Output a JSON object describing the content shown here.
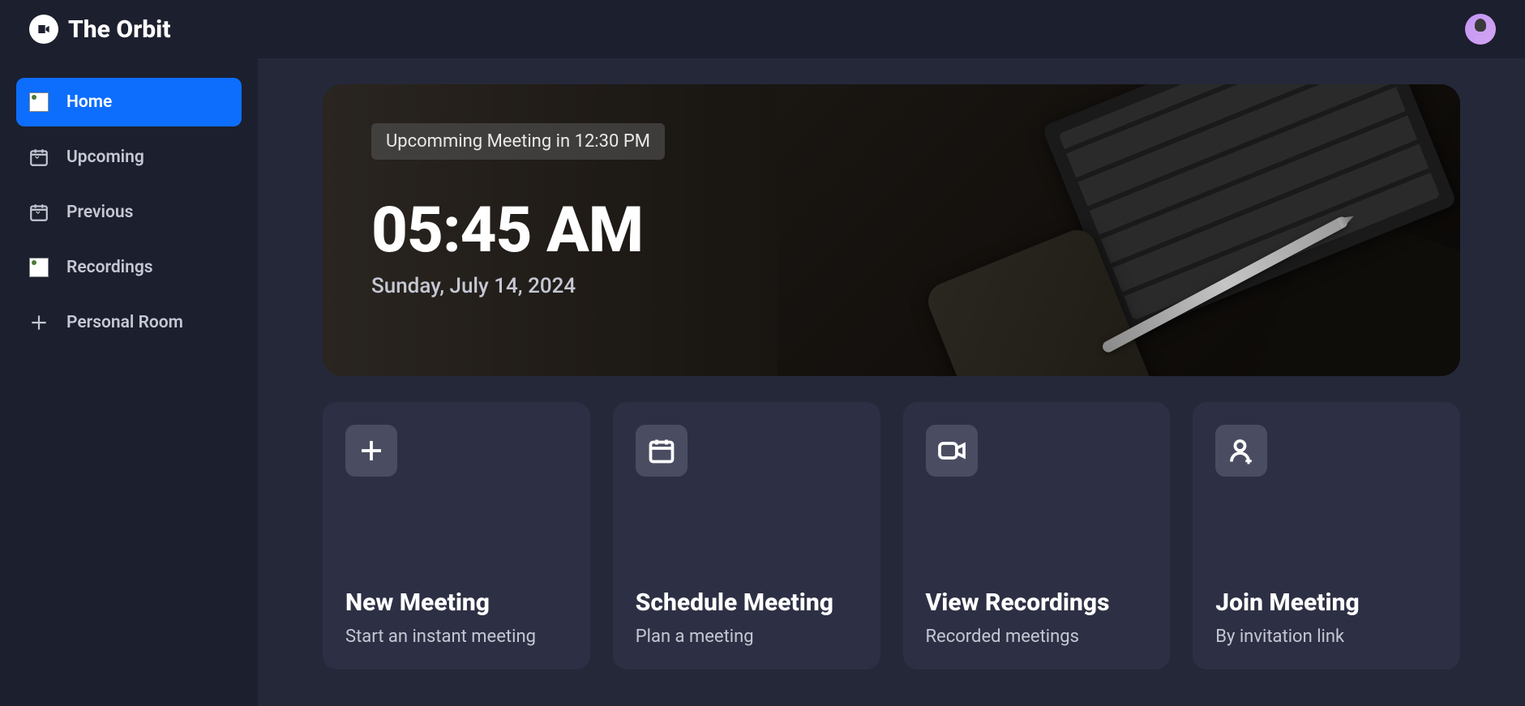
{
  "brand": {
    "name": "The Orbit"
  },
  "sidebar": {
    "items": [
      {
        "label": "Home",
        "icon": "home-icon",
        "active": true
      },
      {
        "label": "Upcoming",
        "icon": "calendar-upcoming-icon",
        "active": false
      },
      {
        "label": "Previous",
        "icon": "calendar-previous-icon",
        "active": false
      },
      {
        "label": "Recordings",
        "icon": "recordings-icon",
        "active": false
      },
      {
        "label": "Personal Room",
        "icon": "plus-icon",
        "active": false
      }
    ]
  },
  "hero": {
    "upcoming_badge": "Upcomming Meeting in 12:30 PM",
    "time": "05:45 AM",
    "date": "Sunday, July 14, 2024"
  },
  "cards": [
    {
      "title": "New Meeting",
      "subtitle": "Start an instant meeting",
      "icon": "plus-icon"
    },
    {
      "title": "Schedule Meeting",
      "subtitle": "Plan a meeting",
      "icon": "calendar-icon"
    },
    {
      "title": "View Recordings",
      "subtitle": "Recorded meetings",
      "icon": "video-icon"
    },
    {
      "title": "Join Meeting",
      "subtitle": "By invitation link",
      "icon": "user-plus-icon"
    }
  ]
}
